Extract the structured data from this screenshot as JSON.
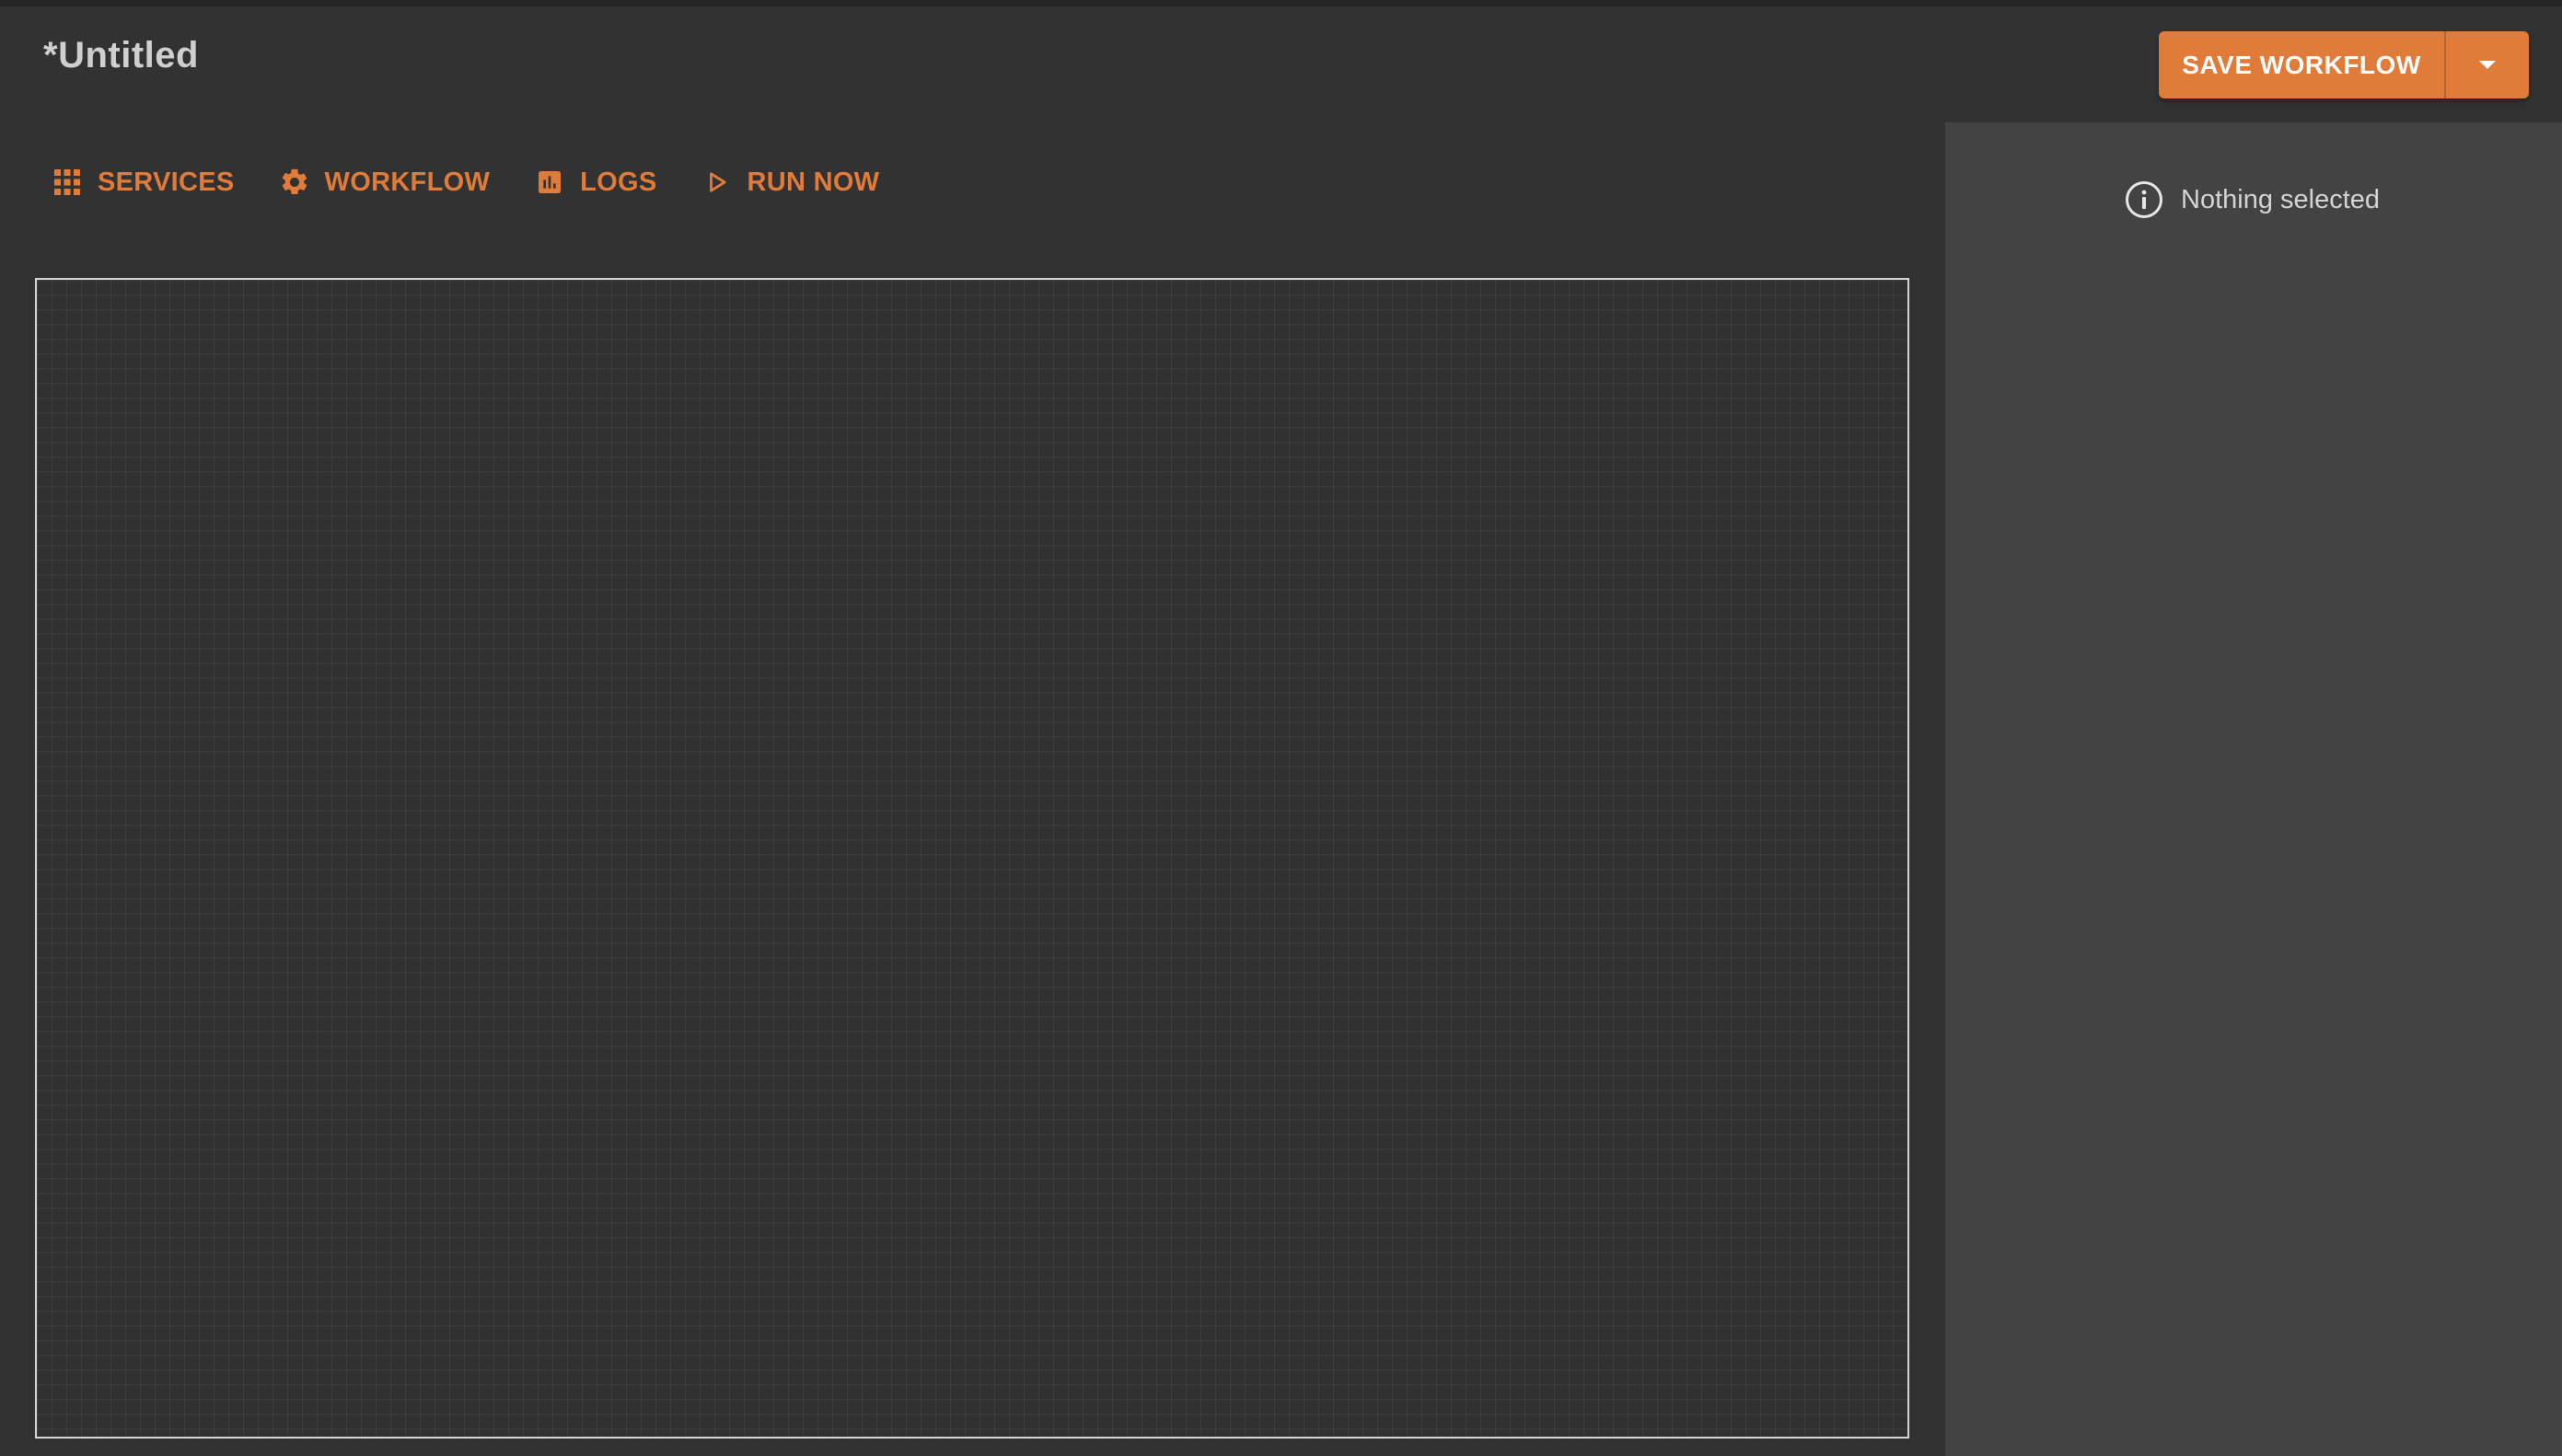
{
  "header": {
    "title": "*Untitled",
    "save_label": "SAVE WORKFLOW"
  },
  "toolbar": {
    "items": [
      {
        "label": "SERVICES",
        "icon": "grid-icon"
      },
      {
        "label": "WORKFLOW",
        "icon": "gear-icon"
      },
      {
        "label": "LOGS",
        "icon": "bar-chart-icon"
      },
      {
        "label": "RUN NOW",
        "icon": "play-icon"
      }
    ]
  },
  "panel": {
    "empty_text": "Nothing selected",
    "icon": "info-icon"
  },
  "colors": {
    "accent": "#e07b39",
    "background": "#323232",
    "panel": "#434343"
  }
}
